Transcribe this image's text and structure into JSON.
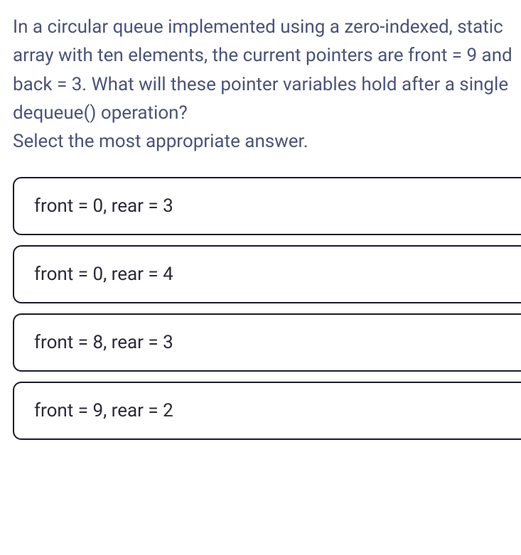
{
  "question": {
    "line1": "In a circular queue implemented using a zero-indexed, static array with ten elements, the current pointers are front = 9 and back = 3. What will these pointer variables hold after a single dequeue() operation?",
    "line2": "Select the most appropriate answer."
  },
  "options": [
    {
      "label": "front = 0, rear = 3"
    },
    {
      "label": "front = 0, rear = 4"
    },
    {
      "label": "front = 8, rear = 3"
    },
    {
      "label": "front = 9, rear = 2"
    }
  ]
}
